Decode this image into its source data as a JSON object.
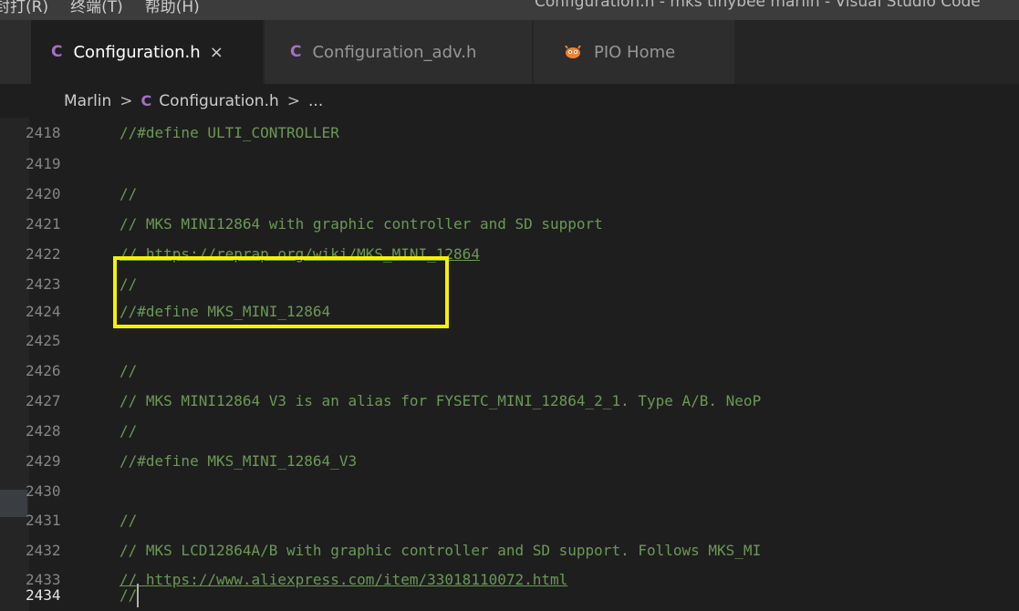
{
  "menubar": {
    "items": [
      "封打(R)",
      "终端(T)",
      "帮助(H)"
    ],
    "window_title": "Configuration.h - mks tinybee marlin - Visual Studio Code"
  },
  "tabs": [
    {
      "label": "Configuration.h",
      "icon": "c-file-icon",
      "active": true
    },
    {
      "label": "Configuration_adv.h",
      "icon": "c-file-icon",
      "active": false
    },
    {
      "label": "PIO Home",
      "icon": "platformio-icon",
      "active": false
    }
  ],
  "icons": {
    "c_glyph": "C",
    "close": "×",
    "breadcrumb_sep": ">",
    "ellipsis": "..."
  },
  "breadcrumb": {
    "folder": "Marlin",
    "file": "Configuration.h"
  },
  "editor": {
    "current_line": "2434",
    "lines": [
      {
        "n": "2418",
        "text": "//#define ULTI_CONTROLLER"
      },
      {
        "n": "2419",
        "text": ""
      },
      {
        "n": "2420",
        "text": "//"
      },
      {
        "n": "2421",
        "text": "// MKS MINI12864 with graphic controller and SD support"
      },
      {
        "n": "2422",
        "text": "// https://reprap.org/wiki/MKS_MINI_12864"
      },
      {
        "n": "2423",
        "text": "//"
      },
      {
        "n": "2424",
        "text": "//#define MKS_MINI_12864"
      },
      {
        "n": "2425",
        "text": ""
      },
      {
        "n": "2426",
        "text": "//"
      },
      {
        "n": "2427",
        "text": "// MKS MINI12864 V3 is an alias for FYSETC_MINI_12864_2_1. Type A/B. NeoP"
      },
      {
        "n": "2428",
        "text": "//"
      },
      {
        "n": "2429",
        "text": "//#define MKS_MINI_12864_V3"
      },
      {
        "n": "2430",
        "text": ""
      },
      {
        "n": "2431",
        "text": "//"
      },
      {
        "n": "2432",
        "text": "// MKS LCD12864A/B with graphic controller and SD support. Follows MKS_MI"
      },
      {
        "n": "2433",
        "text": "// https://www.aliexpress.com/item/33018110072.html"
      },
      {
        "n": "2434",
        "text": "//"
      }
    ]
  },
  "colors": {
    "comment": "#6a9955",
    "highlight_box": "#f5f200",
    "c_icon": "#a074c4",
    "pio_icon": "#f5822a"
  }
}
